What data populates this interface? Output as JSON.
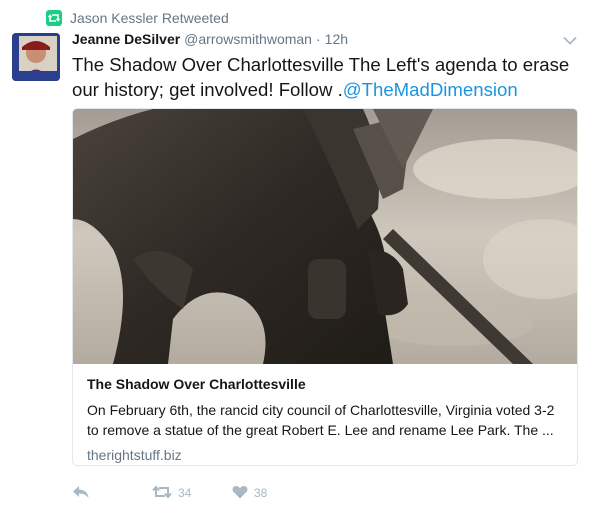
{
  "retweet_context": {
    "label": "Jason Kessler Retweeted",
    "icon": "retweet-icon",
    "icon_color": "#19cf86"
  },
  "tweet": {
    "author_name": "Jeanne DeSilver",
    "author_handle": "@arrowsmithwoman",
    "separator": "·",
    "timestamp": "12h",
    "text_before_mention": "The Shadow Over Charlottesville The Left's agenda to erase our history; get involved! Follow .",
    "mention": "@TheMadDimension",
    "mention_color": "#1b95e0"
  },
  "card": {
    "title": "The Shadow Over Charlottesville",
    "description_line1": "On February 6th, the rancid city council of Charlottesville, Virginia voted 3-2",
    "description_line2": "to remove a statue of the great Robert E. Lee and rename Lee Park. The ...",
    "domain": "therightstuff.biz"
  },
  "actions": {
    "reply_icon": "reply-icon",
    "retweet_icon": "retweet-icon",
    "retweet_count": "34",
    "like_icon": "heart-icon",
    "like_count": "38"
  }
}
